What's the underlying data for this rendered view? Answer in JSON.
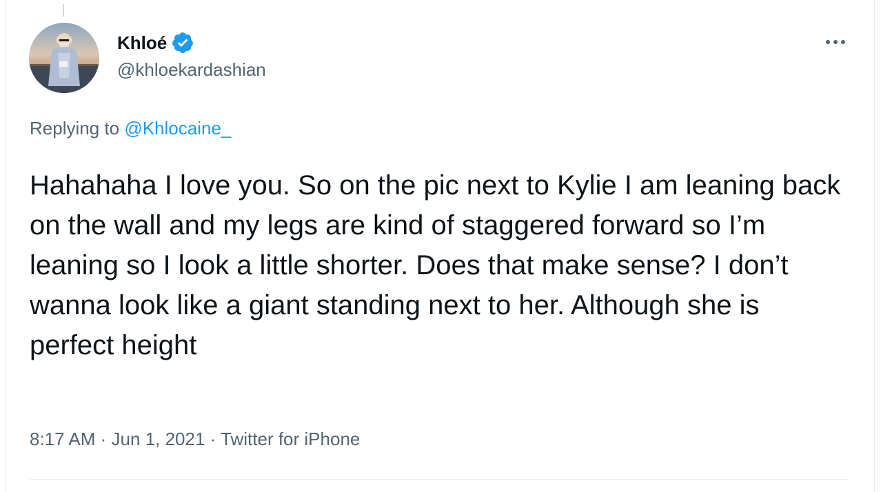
{
  "tweet": {
    "author": {
      "display_name": "Khloé",
      "handle": "@khloekardashian",
      "verified": true,
      "avatar_icon": "profile-photo"
    },
    "more_icon": "more-horizontal-icon",
    "replying_prefix": "Replying to",
    "replying_to": "@Khlocaine_",
    "text": "Hahahaha I love you. So on the pic next to Kylie I am leaning back on the wall and my legs are kind of staggered forward so I’m leaning so I look a little shorter. Does that make sense? I don’t wanna look like a giant standing next to her. Although she is perfect height",
    "time": "8:17 AM",
    "date": "Jun 1, 2021",
    "source": "Twitter for iPhone",
    "separator": " · "
  },
  "colors": {
    "text_primary": "#0f1419",
    "text_secondary": "#536471",
    "accent": "#1d9bf0",
    "border": "#e6ecf0"
  }
}
